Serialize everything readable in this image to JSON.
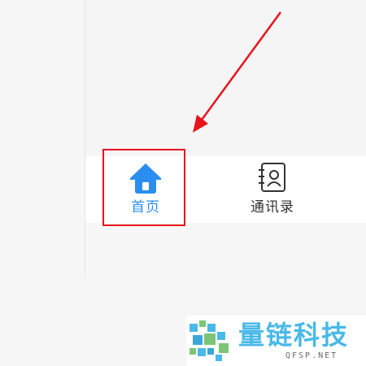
{
  "tab_bar": {
    "tabs": [
      {
        "label": "首页",
        "icon": "home-icon",
        "active": true,
        "color": "#2a8ef0"
      },
      {
        "label": "通讯录",
        "icon": "contacts-book-icon",
        "active": false,
        "color": "#333333"
      }
    ]
  },
  "annotation": {
    "highlight_color": "#e8141c",
    "arrow_color": "#e8141c"
  },
  "watermark": {
    "name": "量链科技",
    "url": "QFSP.NET",
    "logo_icon": "qfsp-logo-icon",
    "accent_color": "#49b9e8"
  }
}
